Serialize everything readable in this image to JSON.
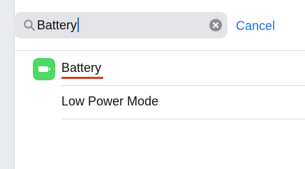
{
  "search": {
    "value": "Battery",
    "cancel_label": "Cancel"
  },
  "results": [
    {
      "label": "Battery",
      "icon": "battery-icon"
    },
    {
      "label": "Low Power Mode"
    }
  ],
  "colors": {
    "accent": "#1a73e8",
    "battery_green": "#4cd964",
    "underline_red": "#d93a1f"
  }
}
